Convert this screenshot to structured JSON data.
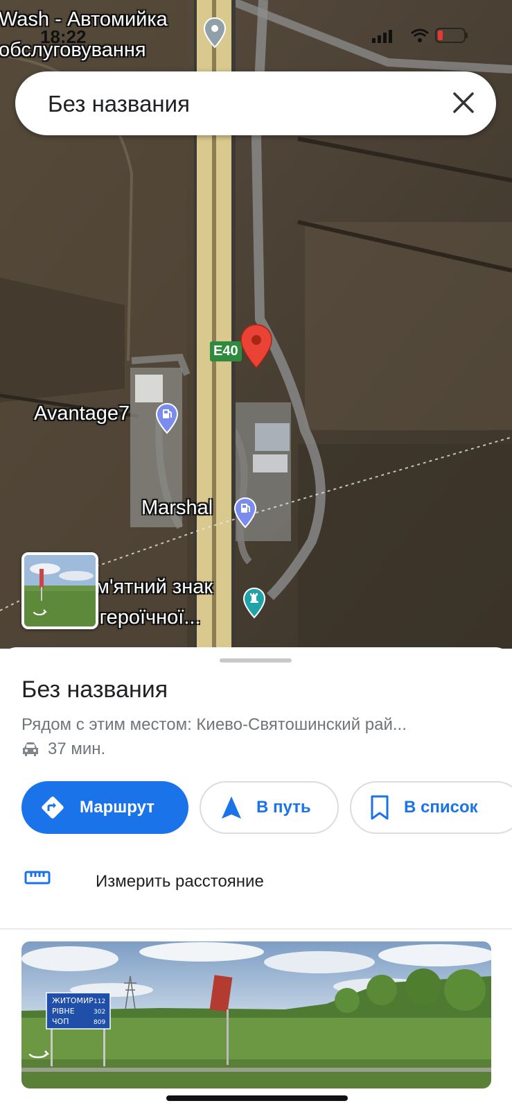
{
  "status": {
    "time": "18:22"
  },
  "map": {
    "labels": {
      "carwash": "Wash - Автомийка",
      "carwash2": "обслуговування",
      "avantage": "Avantage7",
      "marshal": "Marshal",
      "memorial1": "м'ятний знак",
      "memorial2": "початку героїчної..."
    },
    "road_badge": "E40"
  },
  "search": {
    "text": "Без названия"
  },
  "sheet": {
    "title": "Без названия",
    "nearby": "Рядом с этим местом: Киево-Святошинский рай...",
    "drive_time": "37 мин.",
    "buttons": {
      "route": "Маршрут",
      "go": "В путь",
      "save": "В список"
    },
    "measure": "Измерить расстояние"
  },
  "street_sign": {
    "rows": [
      {
        "city": "ЖИТОМИР",
        "km": "112"
      },
      {
        "city": "РІВНЕ",
        "km": "302"
      },
      {
        "city": "ЧОП",
        "km": "809"
      }
    ]
  },
  "colors": {
    "accent": "#1a73e8",
    "pin": "#ea4335",
    "fuel": "#7a8cf0",
    "memorial": "#1fa3a8"
  }
}
